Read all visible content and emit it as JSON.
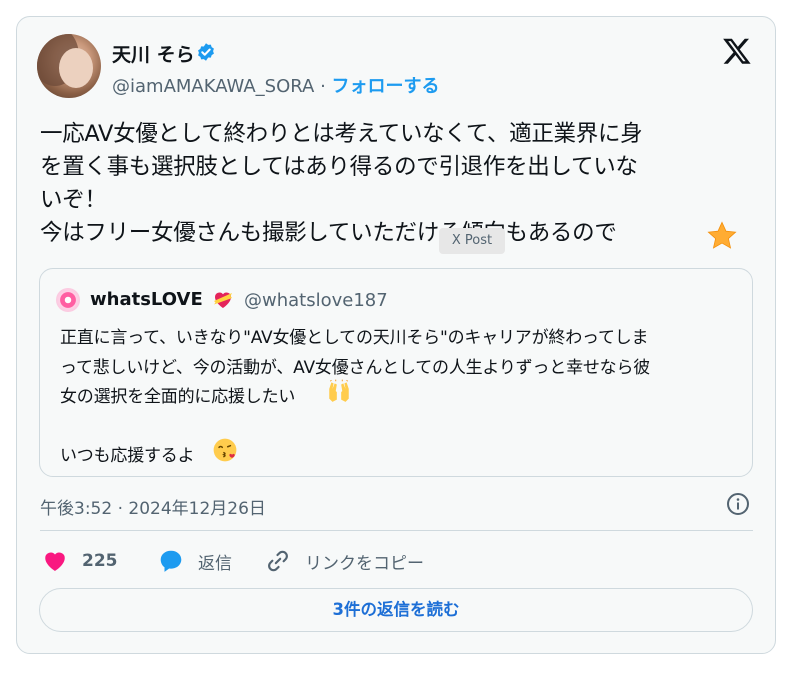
{
  "author": {
    "display_name": "天川 そら",
    "handle": "@iamAMAKAWA_SORA",
    "separator": " · ",
    "follow_label": "フォローする"
  },
  "tweet": {
    "text": "一応AV女優として終わりとは考えていなくて、適正業界に身\nを置く事も選択肢としてはあり得るので引退作を出していな\nいぞ！\n今はフリー女優さんも撮影していただける傾向もあるので",
    "tooltip": "X Post",
    "timestamp": "午後3:52 · 2024年12月26日"
  },
  "quote": {
    "display_name": "whatsLOVE",
    "handle": "@whatslove187",
    "text": "正直に言って、いきなり\"AV女優としての天川そら\"のキャリアが終わってしま\nって悲しいけど、今の活動が、AV女優さんとしての人生よりずっと幸せなら彼\n女の選択を全面的に応援したい\n\nいつも応援するよ"
  },
  "actions": {
    "like_count": "225",
    "reply_label": "返信",
    "copy_link_label": "リンクをコピー"
  },
  "read_replies_label": "3件の返信を読む",
  "colors": {
    "accent": "#1d9bf0",
    "like": "#f91880",
    "border": "#cfd9de",
    "muted": "#536471"
  },
  "icons": [
    "verified-badge-icon",
    "x-logo-icon",
    "star-emoji-icon",
    "heart-with-ribbon-emoji-icon",
    "raised-hands-emoji-icon",
    "kissing-face-emoji-icon",
    "info-icon",
    "heart-icon",
    "reply-bubble-icon",
    "link-icon"
  ]
}
